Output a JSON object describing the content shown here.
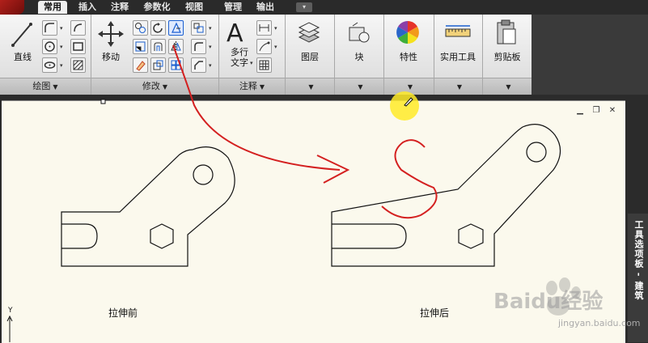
{
  "tabs": [
    "常用",
    "插入",
    "注释",
    "参数化",
    "视图",
    "管理",
    "输出"
  ],
  "active_tab": "常用",
  "ribbon": {
    "line_label": "直线",
    "move_label": "移动",
    "draw_panel": "绘图",
    "modify_panel": "修改",
    "annotate_panel": "注释",
    "multitext_label": "多行\n文字",
    "multitext_line1": "多行",
    "multitext_line2": "文字",
    "layers_label": "图层",
    "block_label": "块",
    "properties_label": "特性",
    "utilities_label": "实用工具",
    "clipboard_label": "剪贴板"
  },
  "drawing": {
    "label_before": "拉伸前",
    "label_after": "拉伸后",
    "ucs_y": "Y"
  },
  "side_palette": "工具选项板 - 建筑",
  "watermark": {
    "brand": "Baidu经验",
    "url": "jingyan.baidu.com"
  },
  "colors": {
    "accent": "#1a5fd0",
    "annotation": "#d42020",
    "canvas": "#fbf9ed"
  }
}
